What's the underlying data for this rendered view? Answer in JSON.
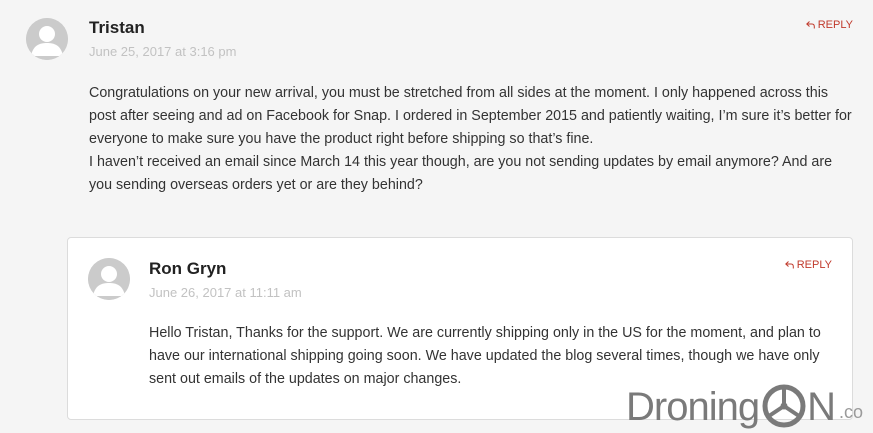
{
  "comments": [
    {
      "author": "Tristan",
      "date": "June 25, 2017 at 3:16 pm",
      "reply_label": "REPLY",
      "paragraphs": [
        "Congratulations on your new arrival, you must be stretched from all sides at the moment. I only happened across this post after seeing and ad on Facebook for Snap. I ordered in September 2015 and patiently waiting, I’m sure it’s better for everyone to make sure you have the product right before shipping so that’s fine.",
        "I haven’t received an email since March 14 this year though, are you not sending updates by email anymore? And are you sending overseas orders yet or are they behind?"
      ]
    }
  ],
  "reply": {
    "author": "Ron Gryn",
    "date": "June 26, 2017 at 11:11 am",
    "reply_label": "REPLY",
    "paragraphs": [
      "Hello Tristan, Thanks for the support. We are currently shipping only in the US for the moment, and plan to have our international shipping going soon. We have updated the blog several times, though we have only sent out emails of the updates on major changes."
    ]
  },
  "watermark": {
    "text_a": "Droning",
    "text_b": "N",
    "suffix": ".co"
  },
  "colors": {
    "reply_accent": "#c0392b",
    "date_gray": "#c2c2c2",
    "page_bg": "#f5f5f5"
  }
}
